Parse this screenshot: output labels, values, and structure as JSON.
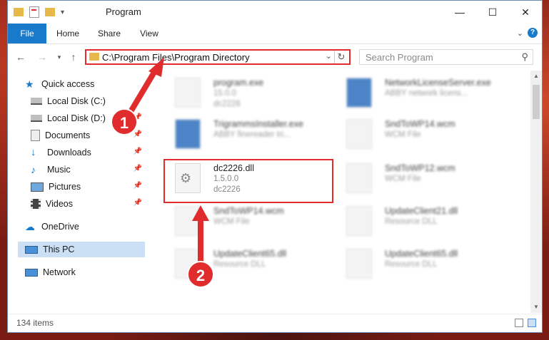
{
  "window": {
    "title": "Program",
    "minimize_icon": "minimize-icon",
    "maximize_icon": "maximize-icon",
    "close_icon": "close-icon"
  },
  "ribbon": {
    "tabs": [
      {
        "label": "File"
      },
      {
        "label": "Home"
      },
      {
        "label": "Share"
      },
      {
        "label": "View"
      }
    ]
  },
  "address": {
    "path": "C:\\Program Files\\Program Directory"
  },
  "search": {
    "placeholder": "Search Program"
  },
  "sidebar": {
    "items": [
      {
        "label": "Quick access",
        "icon": "star-icon"
      },
      {
        "label": "Local Disk (C:)",
        "icon": "drive-icon"
      },
      {
        "label": "Local Disk (D:)",
        "icon": "drive-icon"
      },
      {
        "label": "Documents",
        "icon": "documents-icon"
      },
      {
        "label": "Downloads",
        "icon": "download-icon"
      },
      {
        "label": "Music",
        "icon": "music-icon"
      },
      {
        "label": "Pictures",
        "icon": "pictures-icon"
      },
      {
        "label": "Videos",
        "icon": "video-icon"
      },
      {
        "label": "OneDrive",
        "icon": "cloud-icon"
      },
      {
        "label": "This PC",
        "icon": "computer-icon"
      },
      {
        "label": "Network",
        "icon": "network-icon"
      }
    ]
  },
  "files": [
    {
      "name": "program.exe",
      "line2": "15.0.0",
      "line3": "dc2226"
    },
    {
      "name": "NetworkLicenseServer.exe",
      "line2": "ABBY network licens...",
      "line3": ""
    },
    {
      "name": "TrigrammsInstaller.exe",
      "line2": "ABBY finereader tri...",
      "line3": ""
    },
    {
      "name": "SndToWP14.wcm",
      "line2": "WCM File",
      "line3": ""
    },
    {
      "name": "dc2226.dll",
      "line2": "1.5.0.0",
      "line3": "dc2226"
    },
    {
      "name": "SndToWP12.wcm",
      "line2": "WCM File",
      "line3": ""
    },
    {
      "name": "SndToWP14.wcm",
      "line2": "WCM File",
      "line3": ""
    },
    {
      "name": "UpdateClient21.dll",
      "line2": "Resource DLL",
      "line3": ""
    },
    {
      "name": "UpdateClient65.dll",
      "line2": "Resource DLL",
      "line3": ""
    },
    {
      "name": "UpdateClient65.dll",
      "line2": "Resource DLL",
      "line3": ""
    }
  ],
  "status": {
    "item_count": "134 items"
  },
  "annotations": {
    "step1": "1",
    "step2": "2"
  },
  "colors": {
    "accent": "#1979ca",
    "highlight": "#e02c2c",
    "selection": "#cce0f5"
  }
}
